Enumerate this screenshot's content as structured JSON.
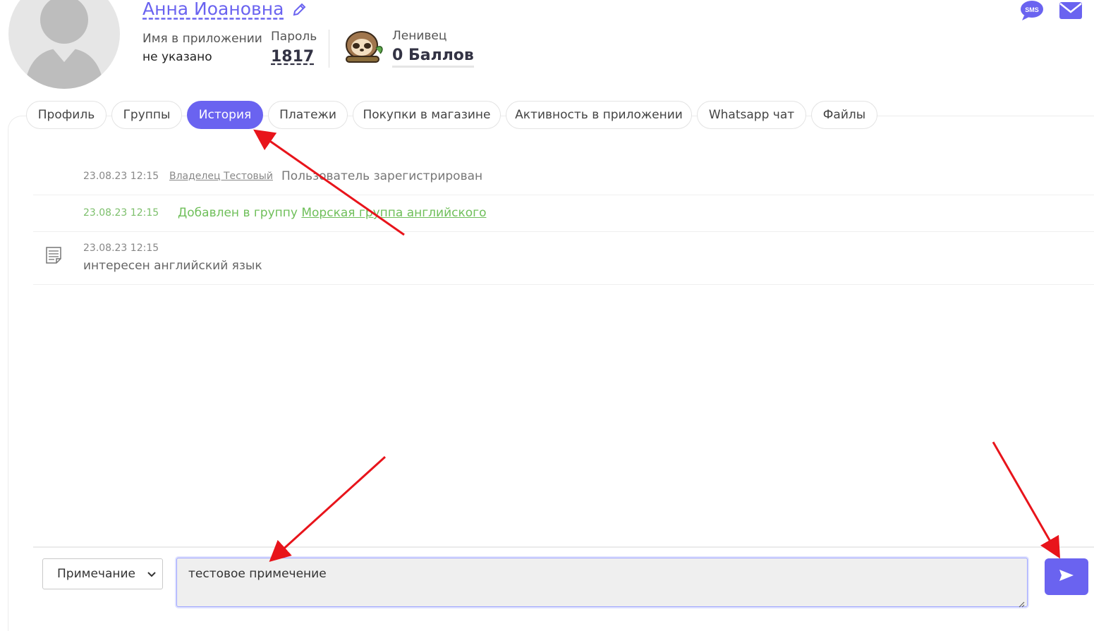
{
  "profile": {
    "name": "Анна Иоановна",
    "app_name_label": "Имя в приложении",
    "app_name_value": "не указано",
    "password_label": "Пароль",
    "password_value": "1817",
    "rank_label": "Ленивец",
    "points": "0 Баллов"
  },
  "header_icons": {
    "sms": "SMS"
  },
  "tabs": [
    {
      "label": "Профиль"
    },
    {
      "label": "Группы"
    },
    {
      "label": "История",
      "active": true
    },
    {
      "label": "Платежи"
    },
    {
      "label": "Покупки в магазине"
    },
    {
      "label": "Активность в приложении"
    },
    {
      "label": "Whatsapp чат"
    },
    {
      "label": "Файлы"
    }
  ],
  "history": [
    {
      "time": "23.08.23 12:15",
      "author": "Владелец Тестовый",
      "text": "Пользователь зарегистрирован"
    },
    {
      "time": "23.08.23 12:15",
      "text": "Добавлен в группу",
      "link": "Морская группа английского"
    },
    {
      "time": "23.08.23 12:15",
      "text": "интересен английский язык",
      "icon": "note-icon"
    }
  ],
  "composer": {
    "type_selected": "Примечание",
    "text_value": "тестовое примечение"
  },
  "colors": {
    "accent": "#6a63f0",
    "green": "#6fbf5a",
    "arrow": "#e8141b"
  }
}
